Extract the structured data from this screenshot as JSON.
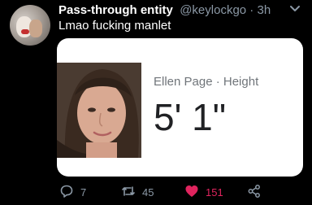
{
  "tweet": {
    "display_name": "Pass-through entity",
    "handle": "@keylockgo",
    "separator": " · ",
    "time": "3h",
    "text": "Lmao fucking manlet"
  },
  "card": {
    "title": "Ellen Page · Height",
    "value": "5' 1\""
  },
  "actions": {
    "reply_count": "7",
    "retweet_count": "45",
    "like_count": "151"
  },
  "colors": {
    "background": "#000000",
    "secondary_text": "#8b98a5",
    "like": "#e0245e"
  },
  "icons": [
    "chevron-down-icon",
    "reply-icon",
    "retweet-icon",
    "heart-icon",
    "share-icon"
  ]
}
